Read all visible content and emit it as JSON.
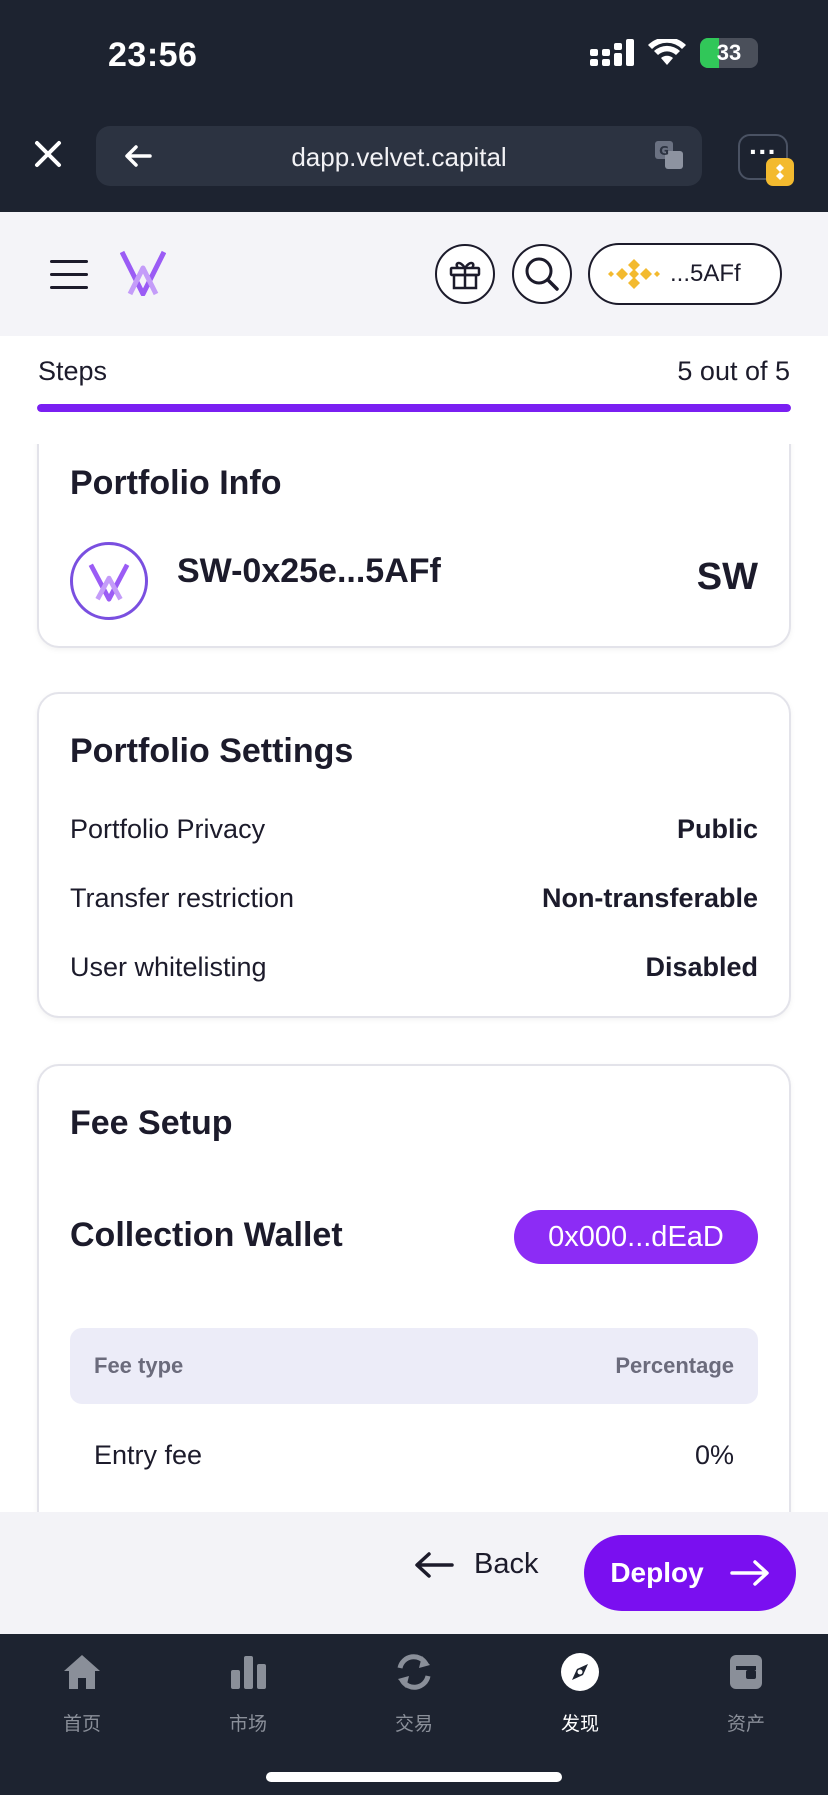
{
  "status": {
    "time": "23:56",
    "battery": "33",
    "battery_level": 0.33
  },
  "browser": {
    "url": "dapp.velvet.capital",
    "more": "···"
  },
  "header": {
    "wallet_address": "...5AFf"
  },
  "steps": {
    "label": "Steps",
    "count": "5 out of 5",
    "progress": 1.0
  },
  "portfolio_info": {
    "title": "Portfolio Info",
    "name": "SW-0x25e...5AFf",
    "symbol": "SW"
  },
  "portfolio_settings": {
    "title": "Portfolio Settings",
    "rows": [
      {
        "label": "Portfolio Privacy",
        "value": "Public"
      },
      {
        "label": "Transfer restriction",
        "value": "Non-transferable"
      },
      {
        "label": "User whitelisting",
        "value": "Disabled"
      }
    ]
  },
  "fee_setup": {
    "title": "Fee Setup",
    "collection_wallet_label": "Collection Wallet",
    "collection_wallet": "0x000...dEaD",
    "columns": [
      "Fee type",
      "Percentage"
    ],
    "rows": [
      {
        "type": "Entry fee",
        "percentage": "0%"
      }
    ]
  },
  "actions": {
    "back": "Back",
    "deploy": "Deploy"
  },
  "tabs": [
    {
      "label": "首页",
      "icon": "home-icon"
    },
    {
      "label": "市场",
      "icon": "market-icon"
    },
    {
      "label": "交易",
      "icon": "trade-icon"
    },
    {
      "label": "发现",
      "icon": "discover-icon",
      "active": true
    },
    {
      "label": "资产",
      "icon": "assets-icon"
    }
  ],
  "colors": {
    "accent": "#7a0ff0",
    "chrome": "#1d2330",
    "binance": "#f3ba2f"
  }
}
